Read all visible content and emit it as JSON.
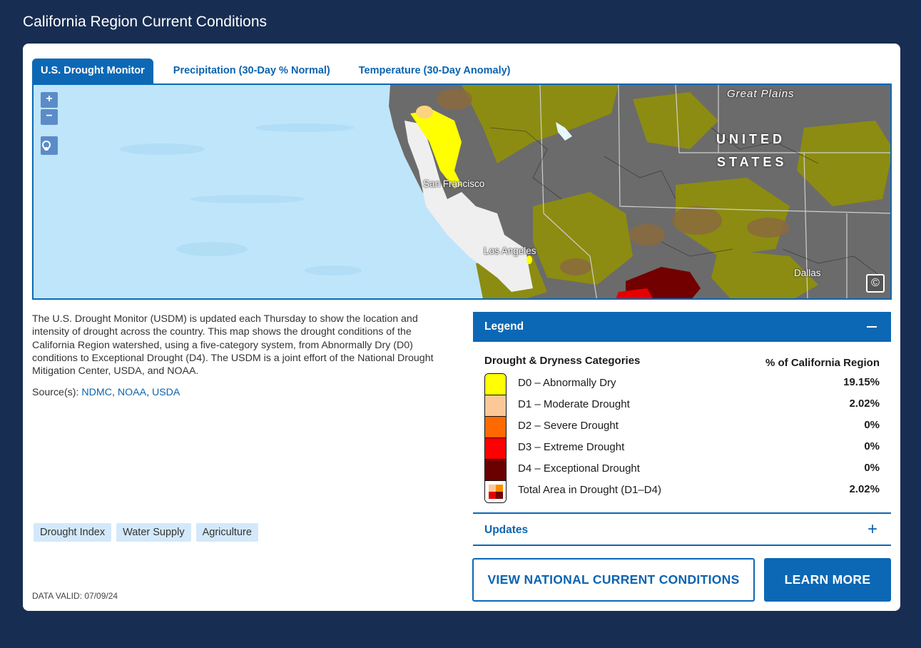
{
  "page": {
    "title": "California Region Current Conditions"
  },
  "tabs": [
    {
      "label": "U.S. Drought Monitor",
      "active": true
    },
    {
      "label": "Precipitation (30-Day % Normal)",
      "active": false
    },
    {
      "label": "Temperature (30-Day Anomaly)",
      "active": false
    }
  ],
  "map": {
    "zoom_in": "+",
    "zoom_out": "−",
    "labels": {
      "great_plains": "Great Plains",
      "united": "UNITED",
      "states": "STATES",
      "san_francisco": "San Francisco",
      "los_angeles": "Los Angeles",
      "dallas": "Dallas"
    },
    "copyright": "©"
  },
  "description": "The U.S. Drought Monitor (USDM) is updated each Thursday to show the location and intensity of drought across the country. This map shows the drought conditions of the California Region watershed, using a five-category system, from Abnormally Dry (D0) conditions to Exceptional Drought (D4). The USDM is a joint effort of the National Drought Mitigation Center, USDA, and NOAA.",
  "sources": {
    "prefix": "Source(s): ",
    "links": [
      "NDMC",
      "NOAA",
      "USDA"
    ]
  },
  "tags": [
    "Drought Index",
    "Water Supply",
    "Agriculture"
  ],
  "data_valid": "DATA VALID: 07/09/24",
  "legend": {
    "title": "Legend",
    "col1": "Drought & Dryness Categories",
    "col2": "% of California Region",
    "rows": [
      {
        "label": "D0 – Abnormally Dry",
        "value": "19.15%",
        "color": "#ffff00"
      },
      {
        "label": "D1 – Moderate Drought",
        "value": "2.02%",
        "color": "#fcd37f"
      },
      {
        "label": "D2 – Severe Drought",
        "value": "0%",
        "color": "#ffaa00"
      },
      {
        "label": "D3 – Extreme Drought",
        "value": "0%",
        "color": "#e60000"
      },
      {
        "label": "D4 – Exceptional Drought",
        "value": "0%",
        "color": "#730000"
      },
      {
        "label": "Total Area in Drought (D1–D4)",
        "value": "2.02%",
        "color": ""
      }
    ]
  },
  "updates": {
    "label": "Updates",
    "icon": "+"
  },
  "buttons": {
    "national": "VIEW NATIONAL CURRENT CONDITIONS",
    "learn_more": "LEARN MORE"
  }
}
